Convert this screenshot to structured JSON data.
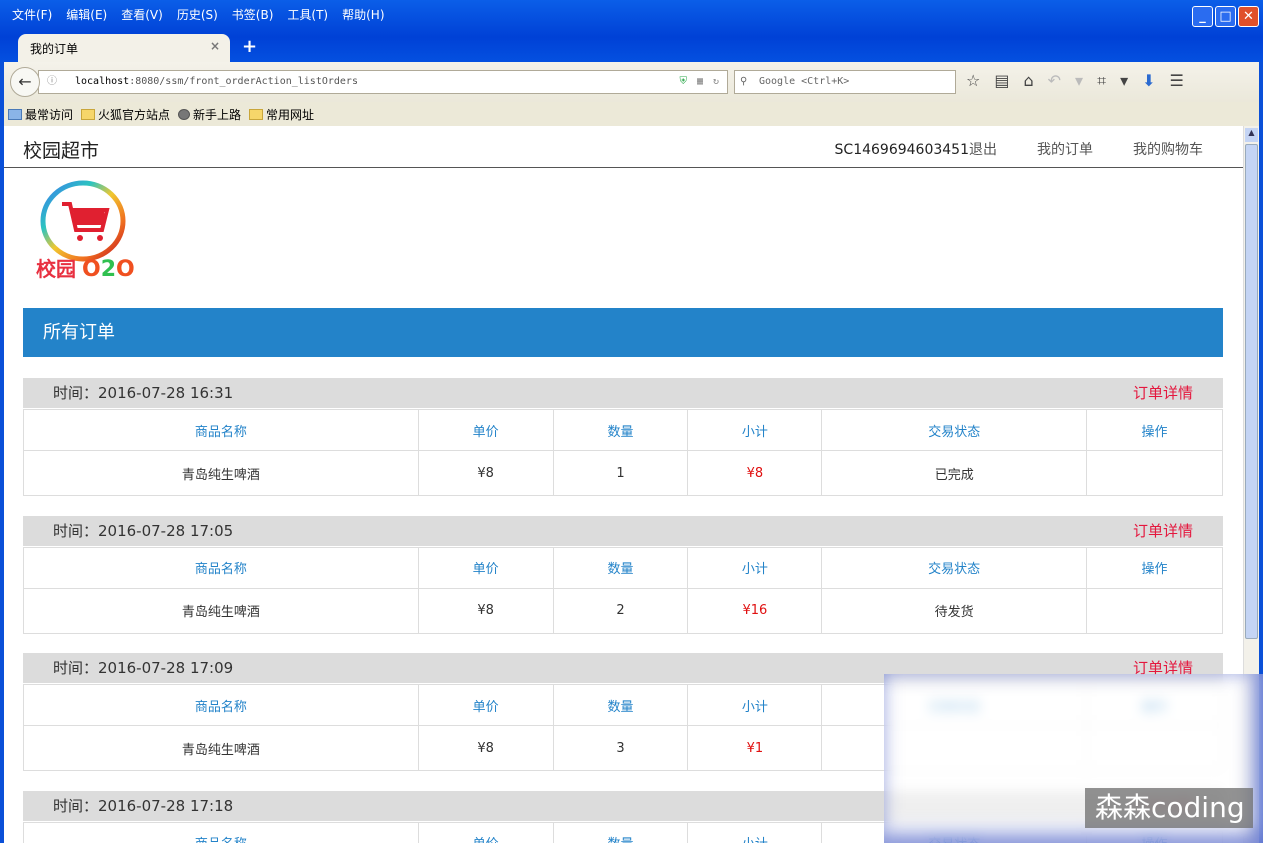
{
  "browser": {
    "menu": [
      "文件(F)",
      "编辑(E)",
      "查看(V)",
      "历史(S)",
      "书签(B)",
      "工具(T)",
      "帮助(H)"
    ],
    "tab_title": "我的订单",
    "url_host": "localhost",
    "url_rest": ":8080/ssm/front_orderAction_listOrders",
    "search_placeholder": "Google <Ctrl+K>",
    "bookmarks": [
      "最常访问",
      "火狐官方站点",
      "新手上路",
      "常用网址"
    ]
  },
  "site": {
    "brand": "校园超市",
    "user": "SC1469694603451",
    "logout": "退出",
    "my_orders": "我的订单",
    "my_cart": "我的购物车",
    "logo_text": "校园O2O",
    "banner": "所有订单"
  },
  "columns": [
    "商品名称",
    "单价",
    "数量",
    "小计",
    "交易状态",
    "操作"
  ],
  "detail_label": "订单详情",
  "orders": [
    {
      "time": "时间：2016-07-28 16:31",
      "item": "青岛纯生啤酒",
      "price": "¥8",
      "qty": "1",
      "subtotal": "¥8",
      "status": "已完成"
    },
    {
      "time": "时间：2016-07-28 17:05",
      "item": "青岛纯生啤酒",
      "price": "¥8",
      "qty": "2",
      "subtotal": "¥16",
      "status": "待发货"
    },
    {
      "time": "时间：2016-07-28 17:09",
      "item": "青岛纯生啤酒",
      "price": "¥8",
      "qty": "3",
      "subtotal": "¥1",
      "status": ""
    },
    {
      "time": "时间：2016-07-28 17:18"
    }
  ],
  "watermark": "森森coding",
  "colors": {
    "accent": "#2383c9",
    "detail": "#e4173e",
    "price": "#e01010"
  }
}
